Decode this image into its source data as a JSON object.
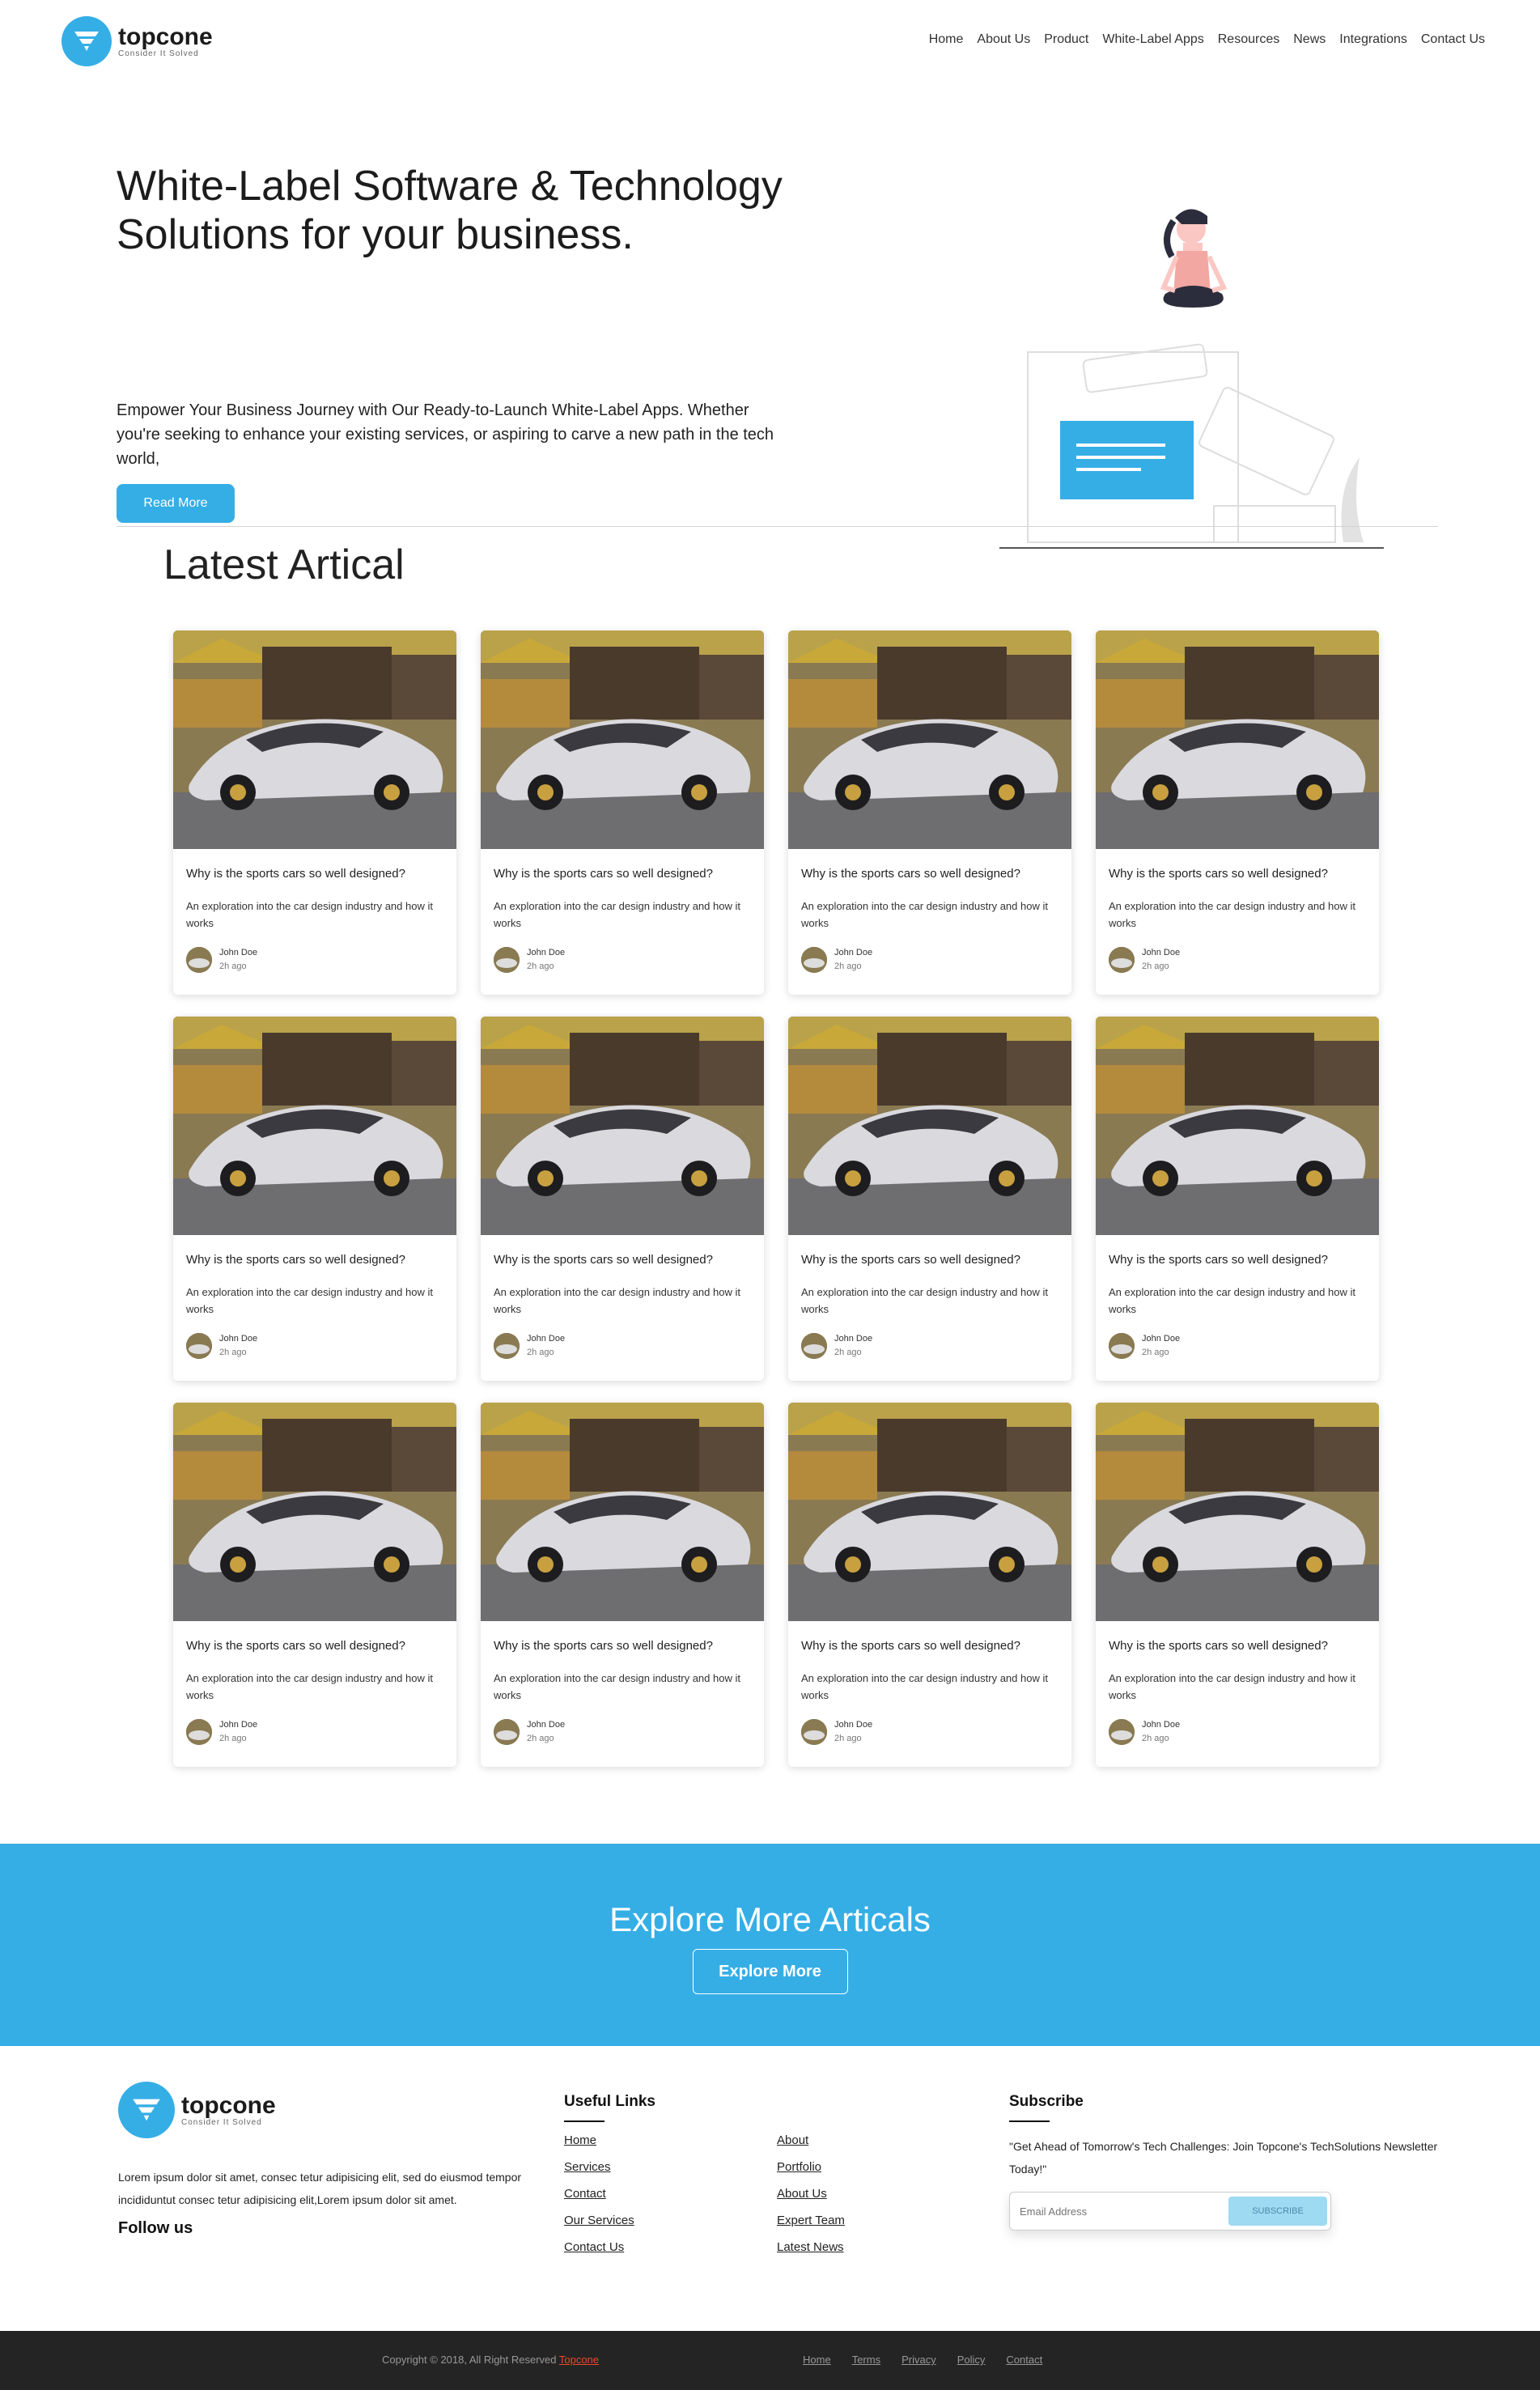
{
  "brand": {
    "name": "topcone",
    "tagline": "Consider It Solved"
  },
  "nav": [
    "Home",
    "About Us",
    "Product",
    "White-Label Apps",
    "Resources",
    "News",
    "Integrations",
    "Contact Us"
  ],
  "hero": {
    "title": "White-Label Software & Technology Solutions for your business.",
    "text": "Empower Your Business Journey with Our Ready-to-Launch White-Label Apps. Whether you're seeking to enhance your existing services, or aspiring to carve a new path in the tech world,",
    "button": "Read More"
  },
  "articles_title": "Latest Artical",
  "cards": [
    {
      "title": "Why is the sports cars so well designed?",
      "desc": "An exploration into the car design industry and how it works",
      "author": "John Doe",
      "time": "2h ago"
    },
    {
      "title": "Why is the sports cars so well designed?",
      "desc": "An exploration into the car design industry and how it works",
      "author": "John Doe",
      "time": "2h ago"
    },
    {
      "title": "Why is the sports cars so well designed?",
      "desc": "An exploration into the car design industry and how it works",
      "author": "John Doe",
      "time": "2h ago"
    },
    {
      "title": "Why is the sports cars so well designed?",
      "desc": "An exploration into the car design industry and how it works",
      "author": "John Doe",
      "time": "2h ago"
    },
    {
      "title": "Why is the sports cars so well designed?",
      "desc": "An exploration into the car design industry and how it works",
      "author": "John Doe",
      "time": "2h ago"
    },
    {
      "title": "Why is the sports cars so well designed?",
      "desc": "An exploration into the car design industry and how it works",
      "author": "John Doe",
      "time": "2h ago"
    },
    {
      "title": "Why is the sports cars so well designed?",
      "desc": "An exploration into the car design industry and how it works",
      "author": "John Doe",
      "time": "2h ago"
    },
    {
      "title": "Why is the sports cars so well designed?",
      "desc": "An exploration into the car design industry and how it works",
      "author": "John Doe",
      "time": "2h ago"
    },
    {
      "title": "Why is the sports cars so well designed?",
      "desc": "An exploration into the car design industry and how it works",
      "author": "John Doe",
      "time": "2h ago"
    },
    {
      "title": "Why is the sports cars so well designed?",
      "desc": "An exploration into the car design industry and how it works",
      "author": "John Doe",
      "time": "2h ago"
    },
    {
      "title": "Why is the sports cars so well designed?",
      "desc": "An exploration into the car design industry and how it works",
      "author": "John Doe",
      "time": "2h ago"
    },
    {
      "title": "Why is the sports cars so well designed?",
      "desc": "An exploration into the car design industry and how it works",
      "author": "John Doe",
      "time": "2h ago"
    }
  ],
  "cta": {
    "title": "Explore More Articals",
    "button": "Explore More"
  },
  "footer": {
    "about": "Lorem ipsum dolor sit amet, consec tetur adipisicing elit, sed do eiusmod tempor incididuntut consec tetur adipisicing elit,Lorem ipsum dolor sit amet.",
    "follow": "Follow us",
    "links_title": "Useful Links",
    "links_col1": [
      "Home",
      "Services",
      "Contact",
      "Our Services",
      "Contact Us"
    ],
    "links_col2": [
      "About",
      "Portfolio",
      "About Us",
      "Expert Team",
      "Latest News"
    ],
    "subscribe_title": "Subscribe",
    "subscribe_text": "\"Get Ahead of Tomorrow's Tech Challenges: Join Topcone's TechSolutions Newsletter Today!\"",
    "email_placeholder": "Email Address",
    "subscribe_button": "SUBSCRIBE"
  },
  "bottom": {
    "copyright": "Copyright © 2018, All Right Reserved",
    "copyright_brand": "Topcone",
    "links": [
      "Home",
      "Terms",
      "Privacy",
      "Policy",
      "Contact"
    ]
  },
  "colors": {
    "accent": "#35aee6",
    "dark": "#242424",
    "brand_link": "#e84a2b"
  }
}
